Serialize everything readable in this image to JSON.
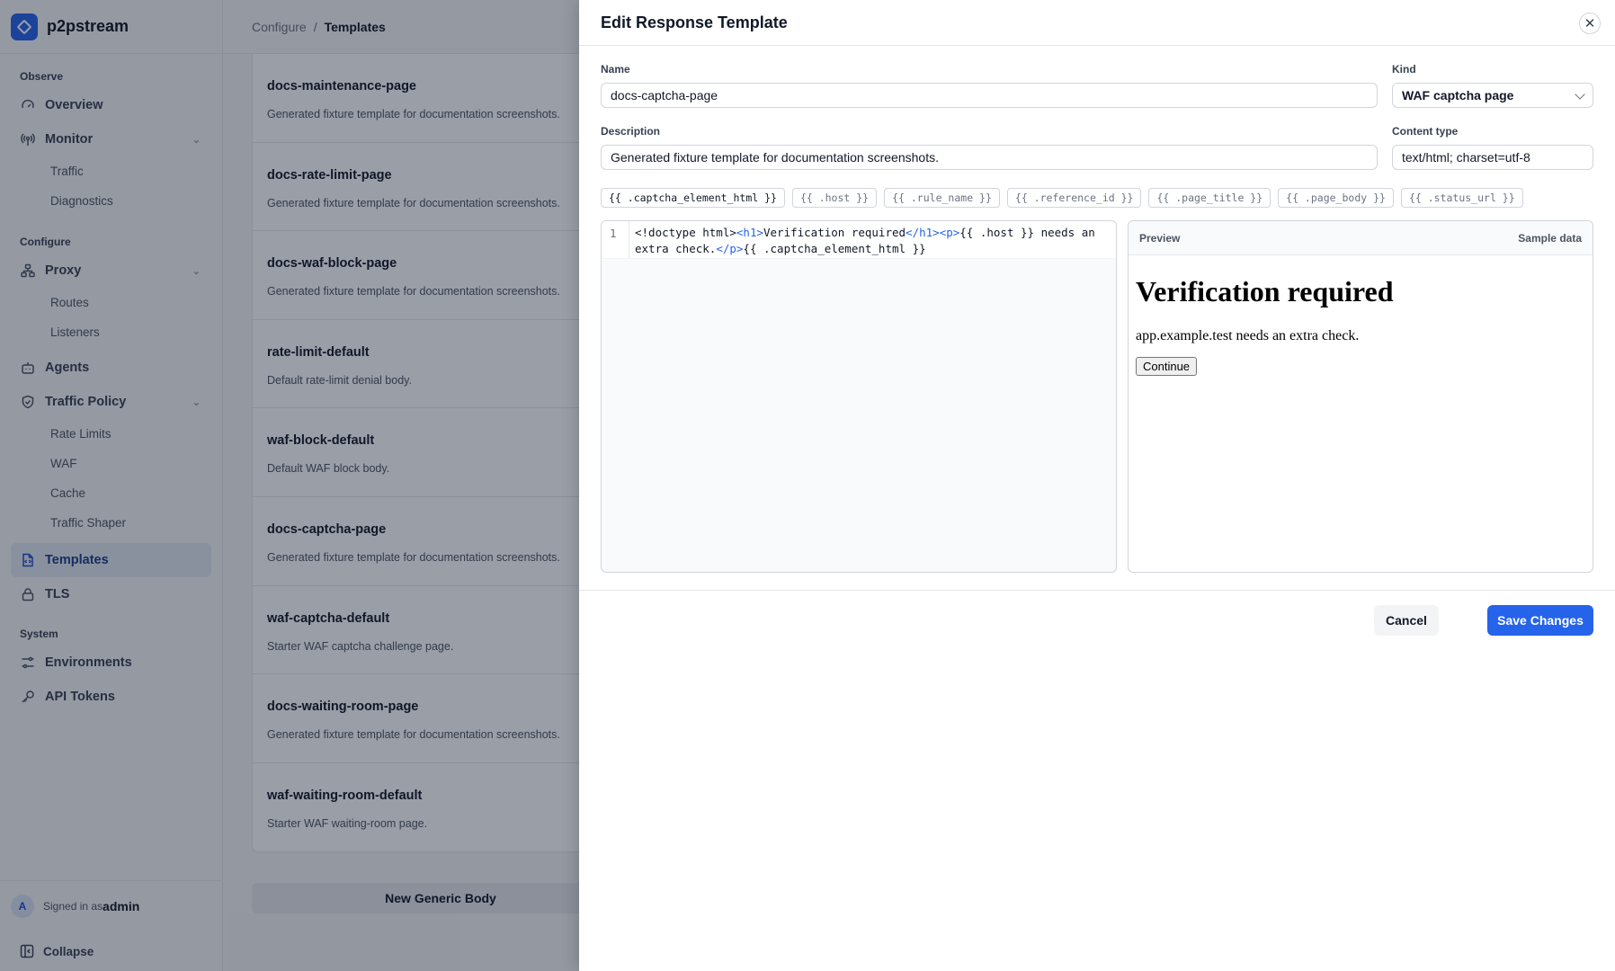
{
  "app": {
    "name": "p2pstream"
  },
  "sidebar": {
    "sections": [
      {
        "title": "Observe"
      },
      {
        "title": "Configure"
      },
      {
        "title": "System"
      }
    ],
    "items": {
      "overview": "Overview",
      "monitor": "Monitor",
      "traffic": "Traffic",
      "diagnostics": "Diagnostics",
      "proxy": "Proxy",
      "routes": "Routes",
      "listeners": "Listeners",
      "agents": "Agents",
      "traffic_policy": "Traffic Policy",
      "rate_limits": "Rate Limits",
      "waf": "WAF",
      "cache": "Cache",
      "traffic_shaper": "Traffic Shaper",
      "templates": "Templates",
      "tls": "TLS",
      "environments": "Environments",
      "api_tokens": "API Tokens"
    },
    "footer": {
      "avatar_initial": "A",
      "signed_in_label": "Signed in as",
      "user": "admin",
      "collapse": "Collapse"
    }
  },
  "breadcrumb": {
    "parent": "Configure",
    "separator": "/",
    "current": "Templates"
  },
  "templates": [
    {
      "name": "docs-maintenance-page",
      "description": "Generated fixture template for documentation screenshots."
    },
    {
      "name": "docs-rate-limit-page",
      "description": "Generated fixture template for documentation screenshots."
    },
    {
      "name": "docs-waf-block-page",
      "description": "Generated fixture template for documentation screenshots."
    },
    {
      "name": "rate-limit-default",
      "description": "Default rate-limit denial body."
    },
    {
      "name": "waf-block-default",
      "description": "Default WAF block body."
    },
    {
      "name": "docs-captcha-page",
      "description": "Generated fixture template for documentation screenshots."
    },
    {
      "name": "waf-captcha-default",
      "description": "Starter WAF captcha challenge page."
    },
    {
      "name": "docs-waiting-room-page",
      "description": "Generated fixture template for documentation screenshots."
    },
    {
      "name": "waf-waiting-room-default",
      "description": "Starter WAF waiting-room page."
    }
  ],
  "new_button": "New Generic Body",
  "drawer": {
    "title": "Edit Response Template",
    "close_icon": "close-icon",
    "name_label": "Name",
    "name_value": "docs-captcha-page",
    "kind_label": "Kind",
    "kind_value": "WAF captcha page",
    "description_label": "Description",
    "description_value": "Generated fixture template for documentation screenshots.",
    "content_type_label": "Content type",
    "content_type_value": "text/html; charset=utf-8",
    "variables": [
      "{{ .captcha_element_html }}",
      "{{ .host }}",
      "{{ .rule_name }}",
      "{{ .reference_id }}",
      "{{ .page_title }}",
      "{{ .page_body }}",
      "{{ .status_url }}"
    ],
    "editor": {
      "line_number": "1",
      "code_parts": {
        "doctype": "<!doctype html>",
        "h1_open": "<h1>",
        "h1_text": "Verification required",
        "h1_close": "</h1>",
        "p_open": "<p>",
        "p_text": "{{ .host }} needs an extra check.",
        "p_close": "</p>",
        "tail": "{{ .captcha_element_html }}"
      }
    },
    "preview": {
      "label": "Preview",
      "sample_label": "Sample data",
      "heading": "Verification required",
      "paragraph": "app.example.test needs an extra check.",
      "button": "Continue"
    },
    "cancel": "Cancel",
    "save": "Save Changes"
  }
}
